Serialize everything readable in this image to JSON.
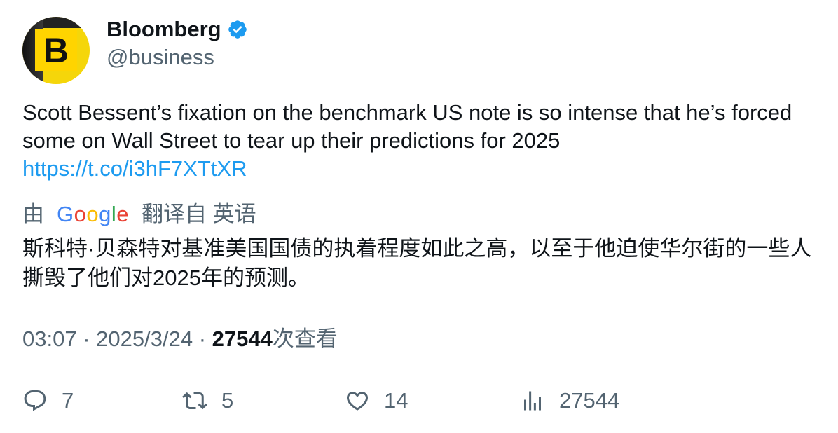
{
  "author": {
    "avatar_letter": "B",
    "name": "Bloomberg",
    "handle": "@business",
    "verified": true
  },
  "tweet": {
    "text": "Scott Bessent’s fixation on the benchmark US note is so intense that he’s forced some on Wall Street to tear up their predictions for 2025",
    "link": "https://t.co/i3hF7XTtXR"
  },
  "translation": {
    "by_label": "由",
    "provider": "Google",
    "from_label": "翻译自 英语",
    "text": "斯科特·贝森特对基准美国国债的执着程度如此之高，以至于他迫使华尔街的一些人撕毁了他们对2025年的预测。"
  },
  "meta": {
    "time": "03:07",
    "separator": "·",
    "date": "2025/3/24",
    "views_count": "27544",
    "views_label": "次查看"
  },
  "actions": {
    "replies": "7",
    "retweets": "5",
    "likes": "14",
    "views": "27544"
  },
  "colors": {
    "accent": "#1d9bf0",
    "muted": "#536471",
    "avatar_yellow": "#ffd400"
  }
}
